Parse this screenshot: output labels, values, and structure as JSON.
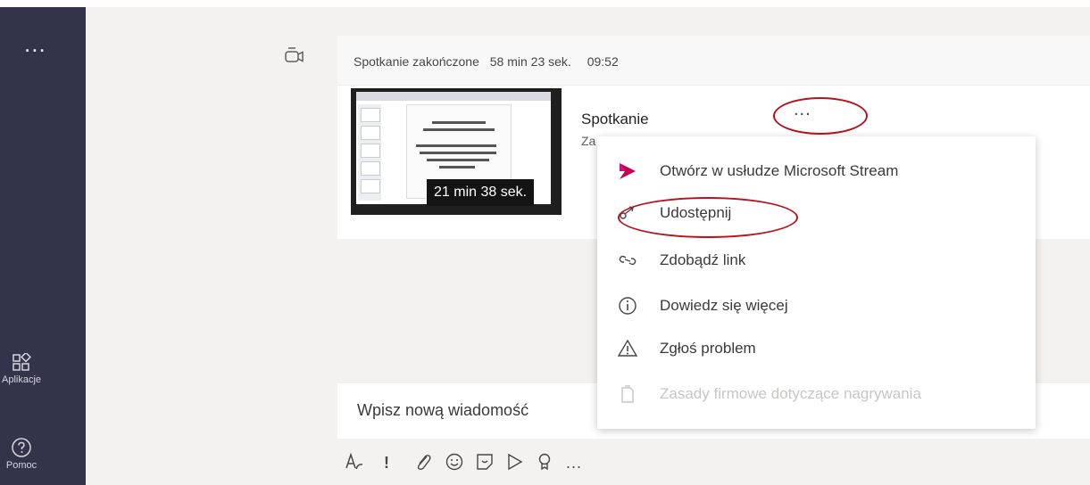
{
  "rail": {
    "more_label": "...",
    "apps_label": "Aplikacje",
    "help_label": "Pomoc"
  },
  "meeting": {
    "status": "Spotkanie zakończone",
    "duration": "58 min 23 sek.",
    "time": "09:52",
    "recording_title": "Spotkanie",
    "recording_sub": "Za",
    "recording_duration": "21 min 38 sek.",
    "more_label": "..."
  },
  "context_menu": {
    "items": [
      {
        "label": "Otwórz w usłudze Microsoft Stream",
        "icon": "microsoft-stream-icon"
      },
      {
        "label": "Udostępnij",
        "icon": "share-icon"
      },
      {
        "label": "Zdobądź link",
        "icon": "link-icon"
      },
      {
        "label": "Dowiedz się więcej",
        "icon": "info-icon"
      },
      {
        "label": "Zgłoś problem",
        "icon": "warning-icon"
      },
      {
        "label": "Zasady firmowe dotyczące nagrywania",
        "icon": "policy-icon",
        "disabled": true
      }
    ]
  },
  "compose": {
    "placeholder": "Wpisz nową wiadomość",
    "more_label": "..."
  },
  "colors": {
    "rail": "#33344a",
    "annotation": "#b5121b",
    "stream_icon": "#c30052"
  }
}
